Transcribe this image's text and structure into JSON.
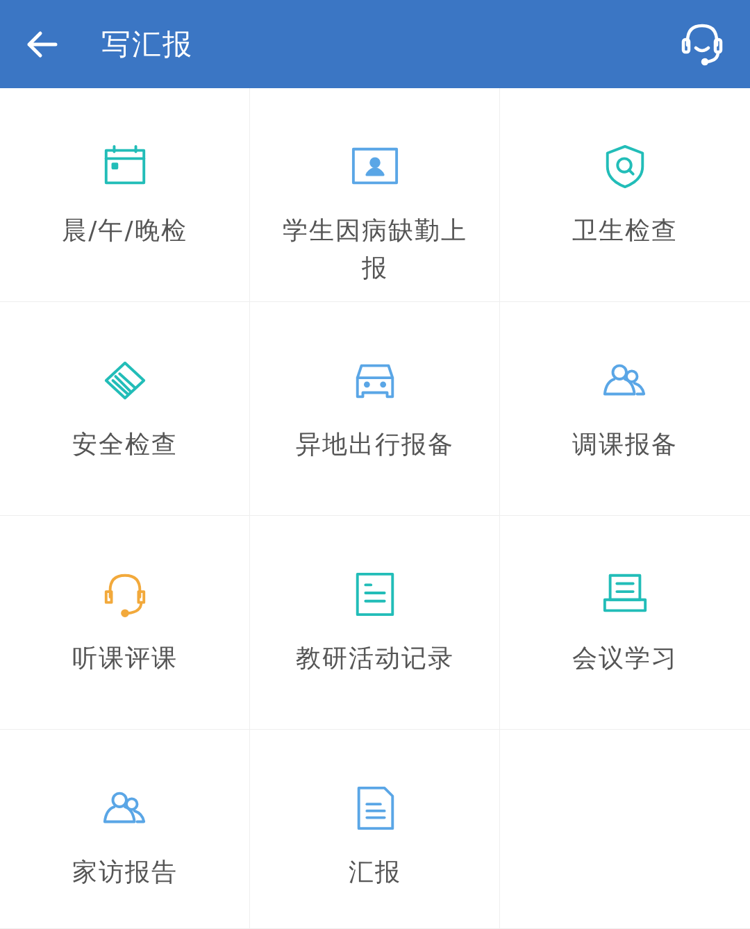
{
  "header": {
    "title": "写汇报"
  },
  "items": [
    {
      "label": "晨/午/晚检",
      "kind": "calendar",
      "color": "#22bdb8"
    },
    {
      "label": "学生因病缺勤上报",
      "kind": "contact",
      "color": "#5aa6e6"
    },
    {
      "label": "卫生检查",
      "kind": "shield",
      "color": "#22bdb8"
    },
    {
      "label": "安全检查",
      "kind": "handshake",
      "color": "#22bdb8"
    },
    {
      "label": "异地出行报备",
      "kind": "car",
      "color": "#5aa6e6"
    },
    {
      "label": "调课报备",
      "kind": "people",
      "color": "#5aa6e6"
    },
    {
      "label": "听课评课",
      "kind": "headset",
      "color": "#f2a93b"
    },
    {
      "label": "教研活动记录",
      "kind": "document",
      "color": "#22bdb8"
    },
    {
      "label": "会议学习",
      "kind": "tray",
      "color": "#22bdb8"
    },
    {
      "label": "家访报告",
      "kind": "people",
      "color": "#5aa6e6"
    },
    {
      "label": "汇报",
      "kind": "file",
      "color": "#5aa6e6"
    }
  ]
}
